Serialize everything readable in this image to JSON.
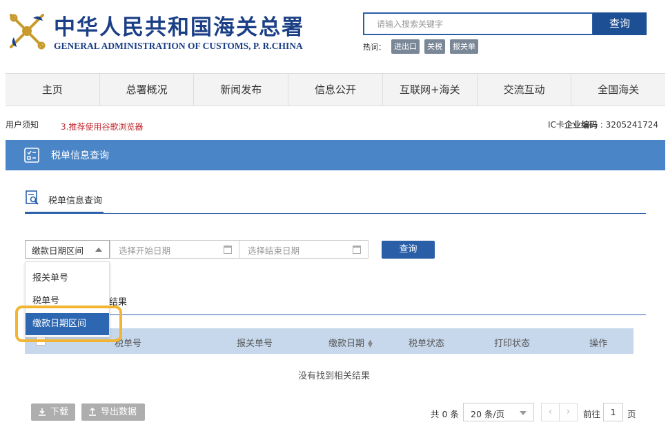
{
  "header": {
    "logo_cn": "中华人民共和国海关总署",
    "logo_en": "GENERAL ADMINISTRATION OF CUSTOMS, P. R.CHINA",
    "search_placeholder": "请输入搜索关键字",
    "search_button": "查询",
    "hot_label": "热词：",
    "hot_tags": [
      "进出口",
      "关税",
      "报关单"
    ]
  },
  "nav": {
    "items": [
      "主页",
      "总署概况",
      "新闻发布",
      "信息公开",
      "互联网+海关",
      "交流互动",
      "全国海关"
    ]
  },
  "notice": {
    "link": "用户须知",
    "text": "3.推荐使用谷歌浏览器",
    "ic_prefix": "IC卡",
    "ic_label": "企业编码",
    "ic_value": ": 3205241724"
  },
  "title_bar": {
    "title": "税单信息查询"
  },
  "subtab": {
    "label": "税单信息查询"
  },
  "filter": {
    "selected": "缴款日期区间",
    "start_placeholder": "选择开始日期",
    "end_placeholder": "选择结束日期",
    "query_button": "查询",
    "options": [
      "报关单号",
      "税单号",
      "缴款日期区间"
    ]
  },
  "results": {
    "tab_partial": "结果",
    "columns": [
      "税单号",
      "报关单号",
      "缴款日期",
      "税单状态",
      "打印状态",
      "操作"
    ],
    "empty_message": "没有找到相关结果"
  },
  "footer": {
    "download_button": "下载",
    "export_button": "导出数据",
    "total": "共 0 条",
    "page_size": "20 条/页",
    "prev": "‹",
    "next": "›",
    "goto_label": "前往",
    "goto_value": "1",
    "goto_suffix": "页"
  },
  "colors": {
    "brand_blue": "#1b3f86",
    "bar_blue": "#4a85c7",
    "highlight": "#f2b531",
    "notice_red": "#c0272d"
  }
}
